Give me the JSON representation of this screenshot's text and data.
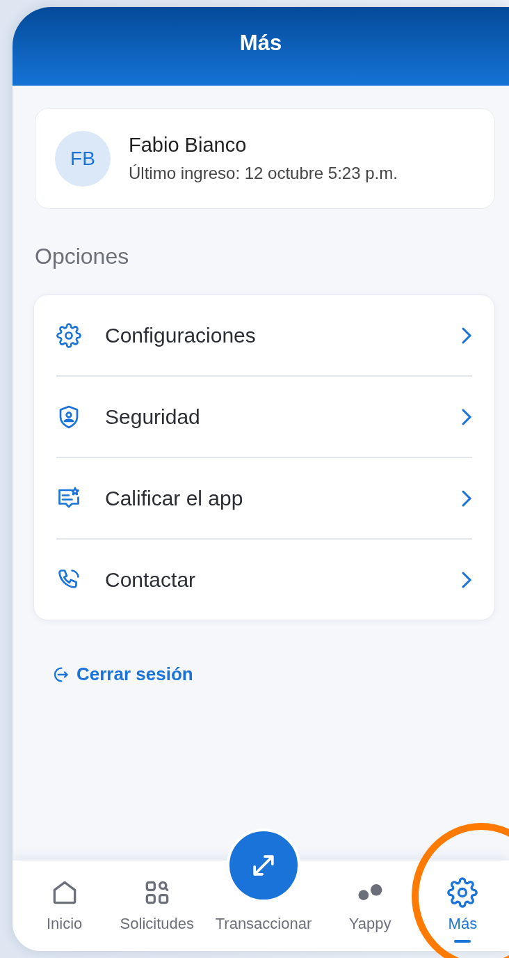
{
  "header": {
    "title": "Más"
  },
  "profile": {
    "initials": "FB",
    "name": "Fabio Bianco",
    "last_login": "Último ingreso: 12 octubre 5:23 p.m."
  },
  "section_title": "Opciones",
  "options": [
    {
      "label": "Configuraciones"
    },
    {
      "label": "Seguridad"
    },
    {
      "label": "Calificar el app"
    },
    {
      "label": "Contactar"
    }
  ],
  "logout": "Cerrar sesión",
  "nav": [
    {
      "label": "Inicio",
      "kind": "tab",
      "selected": false
    },
    {
      "label": "Solicitudes",
      "kind": "tab",
      "selected": false
    },
    {
      "label": "Transaccionar",
      "kind": "fab",
      "selected": false
    },
    {
      "label": "Yappy",
      "kind": "tab",
      "selected": false
    },
    {
      "label": "Más",
      "kind": "tab",
      "selected": true
    }
  ]
}
